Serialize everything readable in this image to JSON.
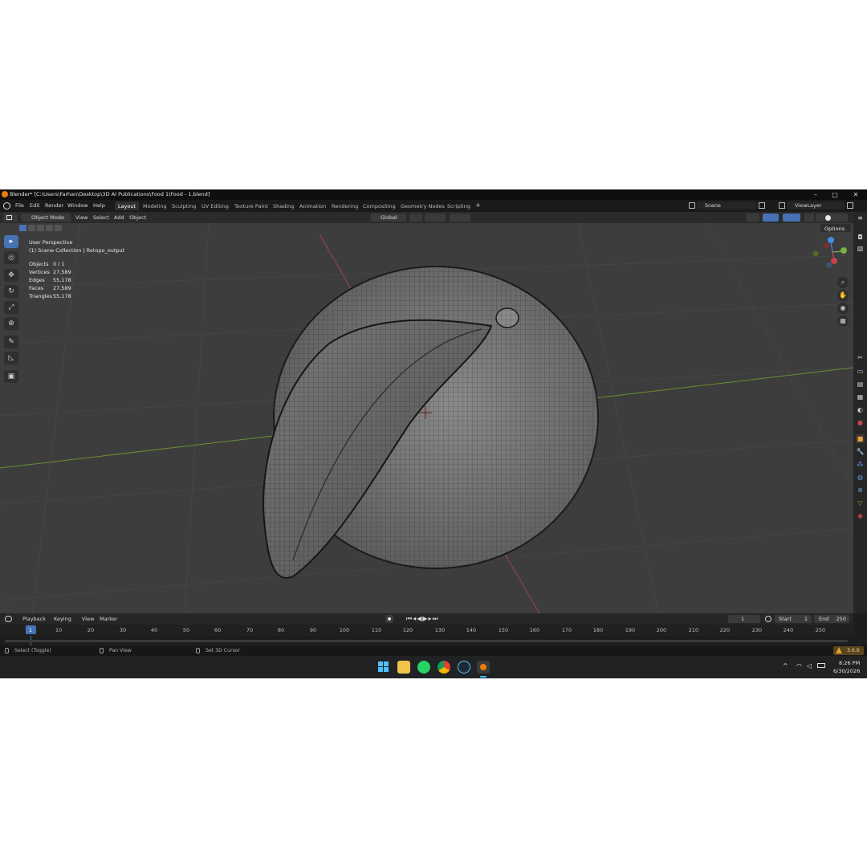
{
  "window": {
    "title": "Blender* [C:\\Users\\Farhan\\Desktop\\3D AI Publications\\Food 1\\Food - 1.blend]",
    "min": "–",
    "max": "□",
    "close": "✕"
  },
  "menu": [
    "File",
    "Edit",
    "Render",
    "Window",
    "Help"
  ],
  "workspaces": [
    {
      "label": "Layout",
      "active": true
    },
    {
      "label": "Modeling"
    },
    {
      "label": "Sculpting"
    },
    {
      "label": "UV Editing"
    },
    {
      "label": "Texture Paint"
    },
    {
      "label": "Shading"
    },
    {
      "label": "Animation"
    },
    {
      "label": "Rendering"
    },
    {
      "label": "Compositing"
    },
    {
      "label": "Geometry Nodes"
    },
    {
      "label": "Scripting"
    }
  ],
  "add_workspace": "+",
  "scene": {
    "label": "Scene"
  },
  "viewlayer": {
    "label": "ViewLayer"
  },
  "header": {
    "mode": "Object Mode",
    "items": [
      "View",
      "Select",
      "Add",
      "Object"
    ],
    "orientation": "Global",
    "options": "Options"
  },
  "viewport": {
    "perspective": "User Perspective",
    "collection": "(1) Scene Collection | Retopo_output",
    "stats": [
      {
        "label": "Objects",
        "value": "0 / 1"
      },
      {
        "label": "Vertices",
        "value": "27,589"
      },
      {
        "label": "Edges",
        "value": "55,178"
      },
      {
        "label": "Faces",
        "value": "27,589"
      },
      {
        "label": "Triangles",
        "value": "55,178"
      }
    ],
    "gizmo": {
      "x": "X",
      "y": "Y",
      "z": "Z"
    }
  },
  "timeline": {
    "menus": [
      "Playback",
      "Keying",
      "View",
      "Marker"
    ],
    "current_frame": "1",
    "start_label": "Start",
    "start": "1",
    "end_label": "End",
    "end": "250",
    "ticks": [
      "1",
      "10",
      "20",
      "30",
      "40",
      "50",
      "60",
      "70",
      "80",
      "90",
      "100",
      "110",
      "120",
      "130",
      "140",
      "150",
      "160",
      "170",
      "180",
      "190",
      "200",
      "210",
      "220",
      "230",
      "240",
      "250"
    ]
  },
  "status": {
    "items": [
      "Select (Toggle)",
      "Pan View",
      "Set 3D Cursor"
    ],
    "version": "3.6.9"
  },
  "taskbar": {
    "time": "8:26 PM",
    "date": "6/30/2026"
  },
  "colors": {
    "accent": "#4772b3",
    "x_axis": "#c8414b",
    "y_axis": "#7cb342",
    "z_axis": "#4a8ae0",
    "warning": "#e0a22a"
  }
}
